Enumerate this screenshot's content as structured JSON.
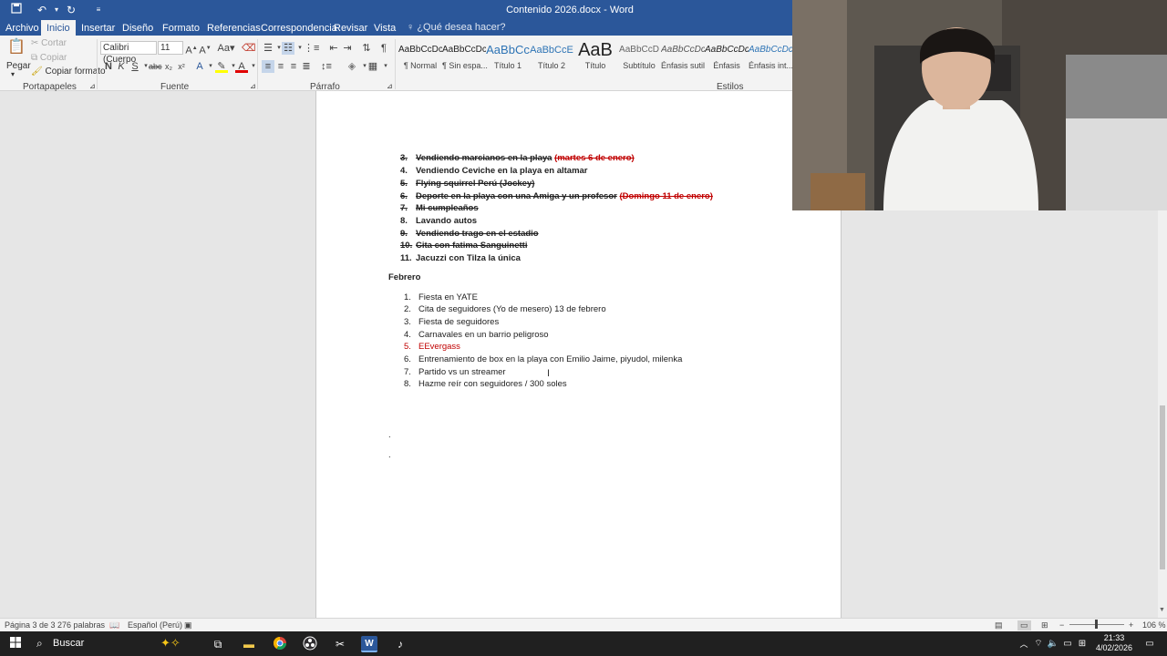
{
  "window": {
    "title": "Contenido 2026.docx - Word"
  },
  "tabs": [
    {
      "label": "Archivo"
    },
    {
      "label": "Inicio"
    },
    {
      "label": "Insertar"
    },
    {
      "label": "Diseño"
    },
    {
      "label": "Formato"
    },
    {
      "label": "Referencias"
    },
    {
      "label": "Correspondencia"
    },
    {
      "label": "Revisar"
    },
    {
      "label": "Vista"
    }
  ],
  "help_search": "¿Qué desea hacer?",
  "ribbon": {
    "clipboard": {
      "paste": "Pegar",
      "cut": "Cortar",
      "copy": "Copiar",
      "format_painter": "Copiar formato",
      "label": "Portapapeles"
    },
    "font": {
      "family": "Calibri (Cuerpo",
      "size": "11",
      "label": "Fuente",
      "bold": "N",
      "italic": "K",
      "underline": "S"
    },
    "paragraph": {
      "label": "Párrafo"
    },
    "styles": {
      "label": "Estilos",
      "items": [
        {
          "preview": "AaBbCcDc",
          "name": "¶ Normal"
        },
        {
          "preview": "AaBbCcDc",
          "name": "¶ Sin espa..."
        },
        {
          "preview": "AaBbCc",
          "name": "Título 1"
        },
        {
          "preview": "AaBbCcE",
          "name": "Título 2"
        },
        {
          "preview": "AaB",
          "name": "Título"
        },
        {
          "preview": "AaBbCcD",
          "name": "Subtítulo"
        },
        {
          "preview": "AaBbCcDc",
          "name": "Énfasis sutil"
        },
        {
          "preview": "AaBbCcDc",
          "name": "Énfasis"
        },
        {
          "preview": "AaBbCcDc",
          "name": "Énfasis int..."
        }
      ]
    }
  },
  "document": {
    "enero": [
      {
        "num": "3.",
        "text": "Vendiendo marcianos en la playa",
        "extra": "(martes 6 de enero)",
        "done": true
      },
      {
        "num": "4.",
        "text": "Vendiendo Ceviche en la playa en altamar",
        "extra": "",
        "done": false
      },
      {
        "num": "5.",
        "text": "Flying squirrel Perú (Jockey)",
        "extra": "",
        "done": true
      },
      {
        "num": "6.",
        "text": "Deporte en la playa con una Amiga y un profesor",
        "extra": "(Domingo 11 de enero)",
        "done": true
      },
      {
        "num": "7.",
        "text": "Mi cumpleaños",
        "extra": "",
        "done": true
      },
      {
        "num": "8.",
        "text": "Lavando autos",
        "extra": "",
        "done": false
      },
      {
        "num": "9.",
        "text": "Vendiendo trago en el estadio",
        "extra": "",
        "done": true
      },
      {
        "num": "10.",
        "text": "Cita con fatima Sanguinetti",
        "extra": "",
        "done": true
      },
      {
        "num": "11.",
        "text": "Jacuzzi con Tilza la única",
        "extra": "",
        "done": false
      }
    ],
    "febrero_heading": "Febrero",
    "febrero": [
      {
        "num": "1.",
        "text": "Fiesta en YATE"
      },
      {
        "num": "2.",
        "text": "Cita de seguidores (Yo de mesero) 13 de febrero"
      },
      {
        "num": "3.",
        "text": "Fiesta de seguidores"
      },
      {
        "num": "4.",
        "text": "Carnavales en un barrio peligroso"
      },
      {
        "num": "5.",
        "text": "EEvergass"
      },
      {
        "num": "6.",
        "text": "Entrenamiento de box en la playa con Emilio Jaime, piyudol, milenka"
      },
      {
        "num": "7.",
        "text": "Partido vs un streamer"
      },
      {
        "num": "8.",
        "text": "Hazme reír con seguidores / 300 soles"
      }
    ],
    "dot1": ".",
    "dot2": "."
  },
  "statusbar": {
    "page": "Página 3 de 3",
    "words": "276 palabras",
    "language": "Español (Perú)",
    "zoom": "106 %"
  },
  "taskbar": {
    "search": "Buscar",
    "time": "21:33",
    "date": "4/02/2026"
  },
  "colors": {
    "word_blue": "#2b579a",
    "strike_red": "#c00000"
  }
}
